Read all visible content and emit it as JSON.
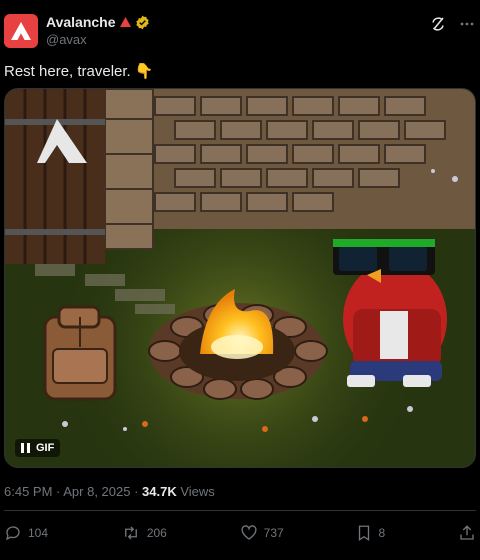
{
  "author": {
    "name": "Avalanche",
    "handle": "@avax"
  },
  "tweet": {
    "text": "Rest here, traveler. 👇"
  },
  "media": {
    "badge": "GIF"
  },
  "meta": {
    "time": "6:45 PM · Apr 8, 2025 · ",
    "views_count": "34.7K",
    "views_label": " Views"
  },
  "stats": {
    "replies": "104",
    "reposts": "206",
    "likes": "737",
    "bookmarks": "8"
  },
  "colors": {
    "brand": "#e84142",
    "verified": "#e2b719"
  },
  "icons": [
    "avalanche-logo-icon",
    "pyramid-icon",
    "verified-badge-icon",
    "grok-icon",
    "more-icon",
    "pause-icon",
    "reply-icon",
    "repost-icon",
    "like-icon",
    "bookmark-icon",
    "share-icon"
  ]
}
